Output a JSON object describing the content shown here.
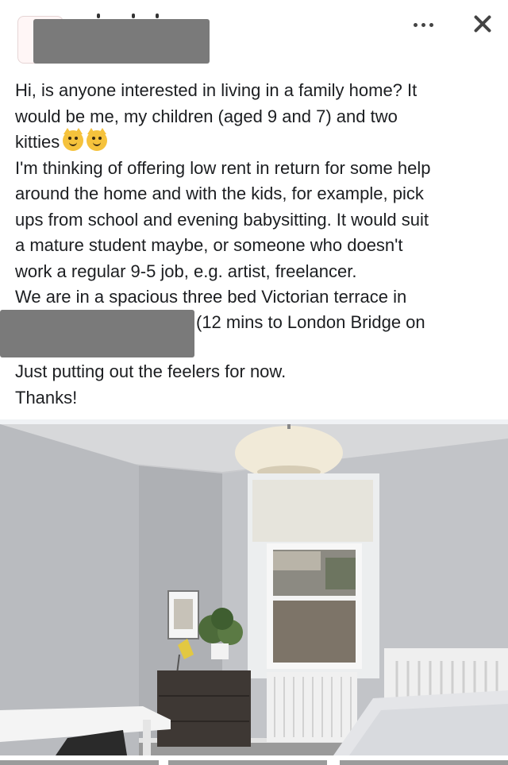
{
  "post": {
    "lines": [
      "Hi, is anyone interested in living in a family home? It",
      "would be me, my children (aged 9 and 7) and two",
      "kitties",
      "I'm thinking of offering low rent in return for some help",
      "around the home and with the kids, for example, pick",
      "ups from school and evening babysitting. It would suit",
      "a mature student maybe, or someone who doesn't",
      "work a regular 9-5 job, e.g. artist, freelancer.",
      "We are in a spacious three bed Victorian terrace in"
    ],
    "location_suffix": "(12 mins to London Bridge on",
    "closing_lines": [
      "Just putting out the feelers for now.",
      "Thanks!"
    ]
  },
  "icons": {
    "more": "more-options-icon",
    "close": "close-icon",
    "emoji_1": "cat-face-emoji",
    "emoji_2": "smiling-cat-emoji"
  },
  "colors": {
    "redaction": "#7a7a7a",
    "text": "#1c1e21",
    "divider": "#f0f2f5"
  }
}
